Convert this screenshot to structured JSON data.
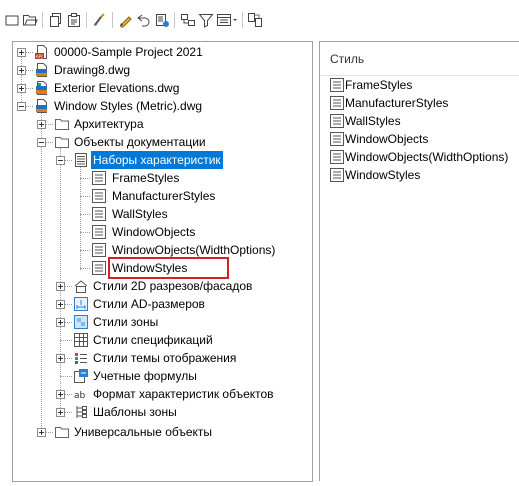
{
  "toolbar": {
    "buttons": [
      {
        "name": "new-icon"
      },
      {
        "name": "open-icon"
      },
      {
        "name": "copy-icon"
      },
      {
        "name": "paste-icon"
      },
      {
        "name": "purge-icon"
      },
      {
        "name": "edit-icon"
      },
      {
        "name": "undo-icon"
      },
      {
        "name": "properties-icon"
      },
      {
        "name": "view-toggle-icon"
      },
      {
        "name": "filter-icon"
      },
      {
        "name": "view-dropdown-icon"
      },
      {
        "name": "synchronize-icon"
      }
    ]
  },
  "tree": {
    "items": [
      {
        "label": "00000-Sample Project 2021",
        "icon": "project-file-icon"
      },
      {
        "label": "Drawing8.dwg",
        "icon": "dwg-file-icon"
      },
      {
        "label": "Exterior Elevations.dwg",
        "icon": "dwg-file-icon"
      },
      {
        "label": "Window Styles (Metric).dwg",
        "icon": "dwg-file-icon"
      },
      {
        "label": "Архитектура",
        "icon": "folder-icon"
      },
      {
        "label": "Объекты документации",
        "icon": "folder-icon"
      },
      {
        "label": "Наборы характеристик",
        "icon": "property-sets-icon",
        "selected": true
      },
      {
        "label": "FrameStyles",
        "icon": "property-set-icon"
      },
      {
        "label": "ManufacturerStyles",
        "icon": "property-set-icon"
      },
      {
        "label": "WallStyles",
        "icon": "property-set-icon"
      },
      {
        "label": "WindowObjects",
        "icon": "property-set-icon"
      },
      {
        "label": "WindowObjects(WidthOptions)",
        "icon": "property-set-icon"
      },
      {
        "label": "WindowStyles",
        "icon": "property-set-icon",
        "highlighted": true
      },
      {
        "label": "Стили 2D разрезов/фасадов",
        "icon": "section-style-icon"
      },
      {
        "label": "Стили AD-размеров",
        "icon": "dimension-style-icon"
      },
      {
        "label": "Стили зоны",
        "icon": "zone-style-icon"
      },
      {
        "label": "Стили спецификаций",
        "icon": "schedule-style-icon"
      },
      {
        "label": "Стили темы отображения",
        "icon": "display-theme-icon"
      },
      {
        "label": "Учетные формулы",
        "icon": "formula-icon"
      },
      {
        "label": "Формат характеристик объектов",
        "icon": "format-icon"
      },
      {
        "label": "Шаблоны зоны",
        "icon": "zone-template-icon"
      },
      {
        "label": "Универсальные объекты",
        "icon": "folder-icon"
      }
    ]
  },
  "list": {
    "header": "Стиль",
    "items": [
      "FrameStyles",
      "ManufacturerStyles",
      "WallStyles",
      "WindowObjects",
      "WindowObjects(WidthOptions)",
      "WindowStyles"
    ]
  }
}
